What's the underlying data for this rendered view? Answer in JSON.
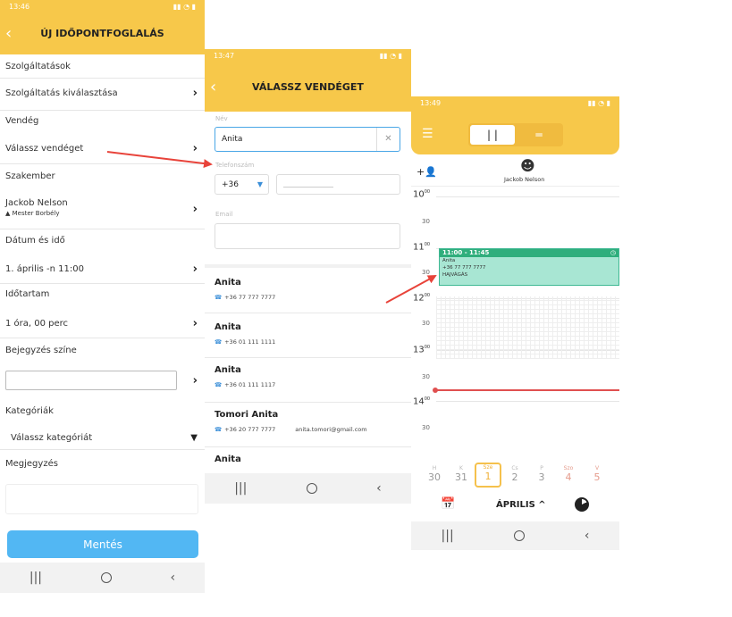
{
  "phone1": {
    "status_time": "13:46",
    "title": "ÚJ IDŐPONTFOGLALÁS",
    "section_services": "Szolgáltatások",
    "service_select": "Szolgáltatás kiválasztása",
    "section_guest": "Vendég",
    "guest_select": "Válassz vendéget",
    "section_specialist": "Szakember",
    "specialist_name": "Jackob Nelson",
    "specialist_salon": "Mester Borbély",
    "section_datetime": "Dátum és idő",
    "datetime_value": "1. április -n 11:00",
    "section_duration": "Időtartam",
    "duration_value": "1 óra, 00 perc",
    "section_color": "Bejegyzés színe",
    "section_categories": "Kategóriák",
    "category_select": "Válassz kategóriát",
    "section_note": "Megjegyzés",
    "save_label": "Mentés"
  },
  "phone2": {
    "status_time": "13:47",
    "title": "VÁLASSZ VENDÉGET",
    "name_label": "Név",
    "name_value": "Anita",
    "phone_label": "Telefonszám",
    "country_code": "+36",
    "email_label": "Email",
    "contacts": [
      {
        "name": "Anita",
        "phone": "+36 77 777 7777",
        "email": ""
      },
      {
        "name": "Anita",
        "phone": "+36 01 111 1111",
        "email": ""
      },
      {
        "name": "Anita",
        "phone": "+36 01 111 1117",
        "email": ""
      },
      {
        "name": "Tomori Anita",
        "phone": "+36 20 777 7777",
        "email": "anita.tomori@gmail.com"
      },
      {
        "name": "Anita",
        "phone": "",
        "email": ""
      }
    ]
  },
  "phone3": {
    "status_time": "13:49",
    "staff_name": "Jackob Nelson",
    "hours": [
      "10",
      "11",
      "12",
      "13",
      "14"
    ],
    "half_label": "30",
    "hour_sup": "00",
    "event": {
      "time": "11:00 - 11:45",
      "name": "Anita",
      "phone": "+36 77 777 7777",
      "category": "HAJVÁGÁS"
    },
    "days": [
      {
        "name": "H",
        "date": "30"
      },
      {
        "name": "K",
        "date": "31"
      },
      {
        "name": "Sze",
        "date": "1"
      },
      {
        "name": "Cs",
        "date": "2"
      },
      {
        "name": "P",
        "date": "3"
      },
      {
        "name": "Szo",
        "date": "4"
      },
      {
        "name": "V",
        "date": "5"
      }
    ],
    "month_label": "ÁPRILIS ^"
  },
  "colors": {
    "accent": "#f7c84a",
    "save_button": "#52b7f3",
    "event": "#2fae7c",
    "now_line": "#e05050",
    "arrow": "#e8433a"
  }
}
